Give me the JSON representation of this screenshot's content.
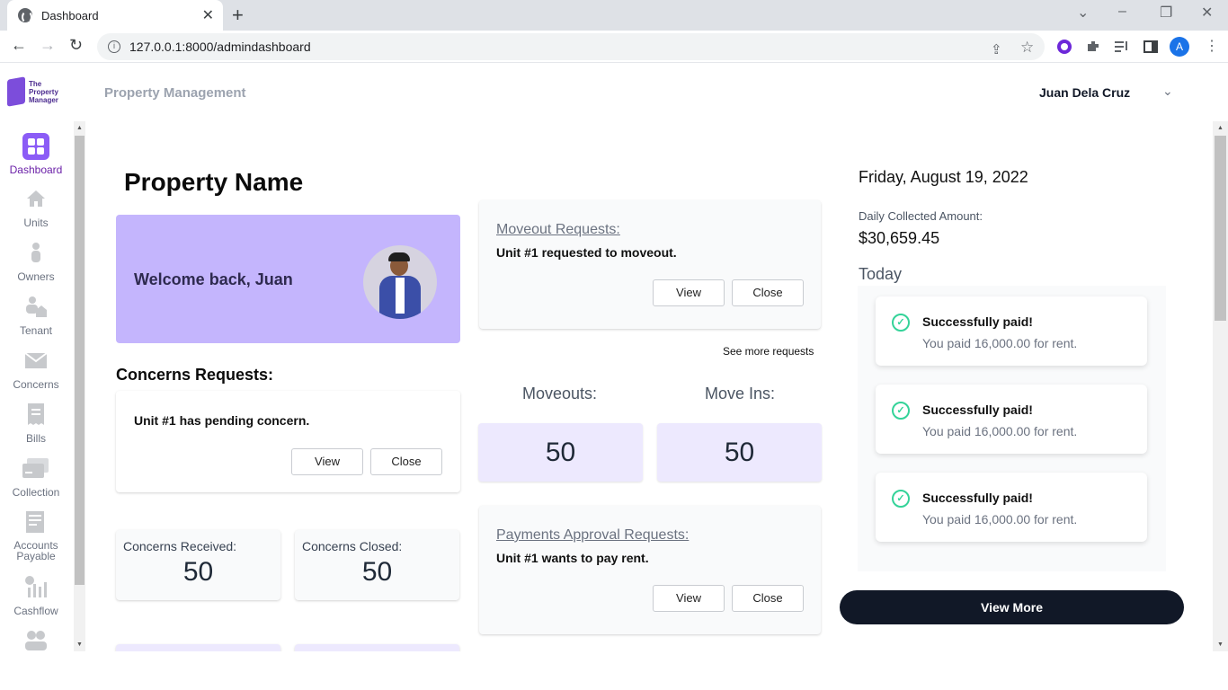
{
  "browser": {
    "tab_title": "Dashboard",
    "url": "127.0.0.1:8000/admindashboard",
    "profile_initial": "A"
  },
  "header": {
    "logo_line1": "The",
    "logo_line2": "Property",
    "logo_line3": "Manager",
    "app_title": "Property Management",
    "user_name": "Juan Dela Cruz"
  },
  "sidebar": {
    "items": [
      {
        "label": "Dashboard",
        "icon": "dashboard-icon",
        "active": true
      },
      {
        "label": "Units",
        "icon": "home-icon"
      },
      {
        "label": "Owners",
        "icon": "user-icon"
      },
      {
        "label": "Tenant",
        "icon": "tenant-icon"
      },
      {
        "label": "Concerns",
        "icon": "mail-icon"
      },
      {
        "label": "Bills",
        "icon": "receipt-icon"
      },
      {
        "label": "Collection",
        "icon": "card-icon"
      },
      {
        "label": "Accounts Payable",
        "icon": "ledger-icon"
      },
      {
        "label": "Cashflow",
        "icon": "cashflow-icon"
      }
    ]
  },
  "main": {
    "property_name": "Property Name",
    "welcome_text": "Welcome back, Juan",
    "concerns_title": "Concerns Requests:",
    "concern_card": {
      "message": "Unit #1 has pending concern.",
      "view_label": "View",
      "close_label": "Close"
    },
    "stats": [
      {
        "label": "Concerns Received:",
        "value": "50"
      },
      {
        "label": "Concerns Closed:",
        "value": "50"
      }
    ],
    "moveout_card": {
      "title": "Moveout Requests:",
      "message": "Unit #1 requested to moveout.",
      "view_label": "View",
      "close_label": "Close"
    },
    "see_more": "See more requests",
    "moveouts": {
      "label": "Moveouts:",
      "value": "50"
    },
    "moveins": {
      "label": "Move Ins:",
      "value": "50"
    },
    "payments_card": {
      "title": "Payments Approval Requests:",
      "message": "Unit #1 wants to pay rent.",
      "view_label": "View",
      "close_label": "Close"
    }
  },
  "right": {
    "date": "Friday, August 19, 2022",
    "daily_label": "Daily Collected Amount:",
    "daily_value": "$30,659.45",
    "today_label": "Today",
    "notifications": [
      {
        "title": "Successfully paid!",
        "body": "You paid 16,000.00 for rent."
      },
      {
        "title": "Successfully paid!",
        "body": "You paid 16,000.00 for rent."
      },
      {
        "title": "Successfully paid!",
        "body": "You paid 16,000.00 for rent."
      }
    ],
    "view_more_label": "View More"
  },
  "colors": {
    "accent": "#8b5cf6",
    "welcome_bg": "#c4b5fd",
    "stat_bg": "#ede9fe",
    "dark_button": "#111827",
    "success": "#34d399"
  }
}
